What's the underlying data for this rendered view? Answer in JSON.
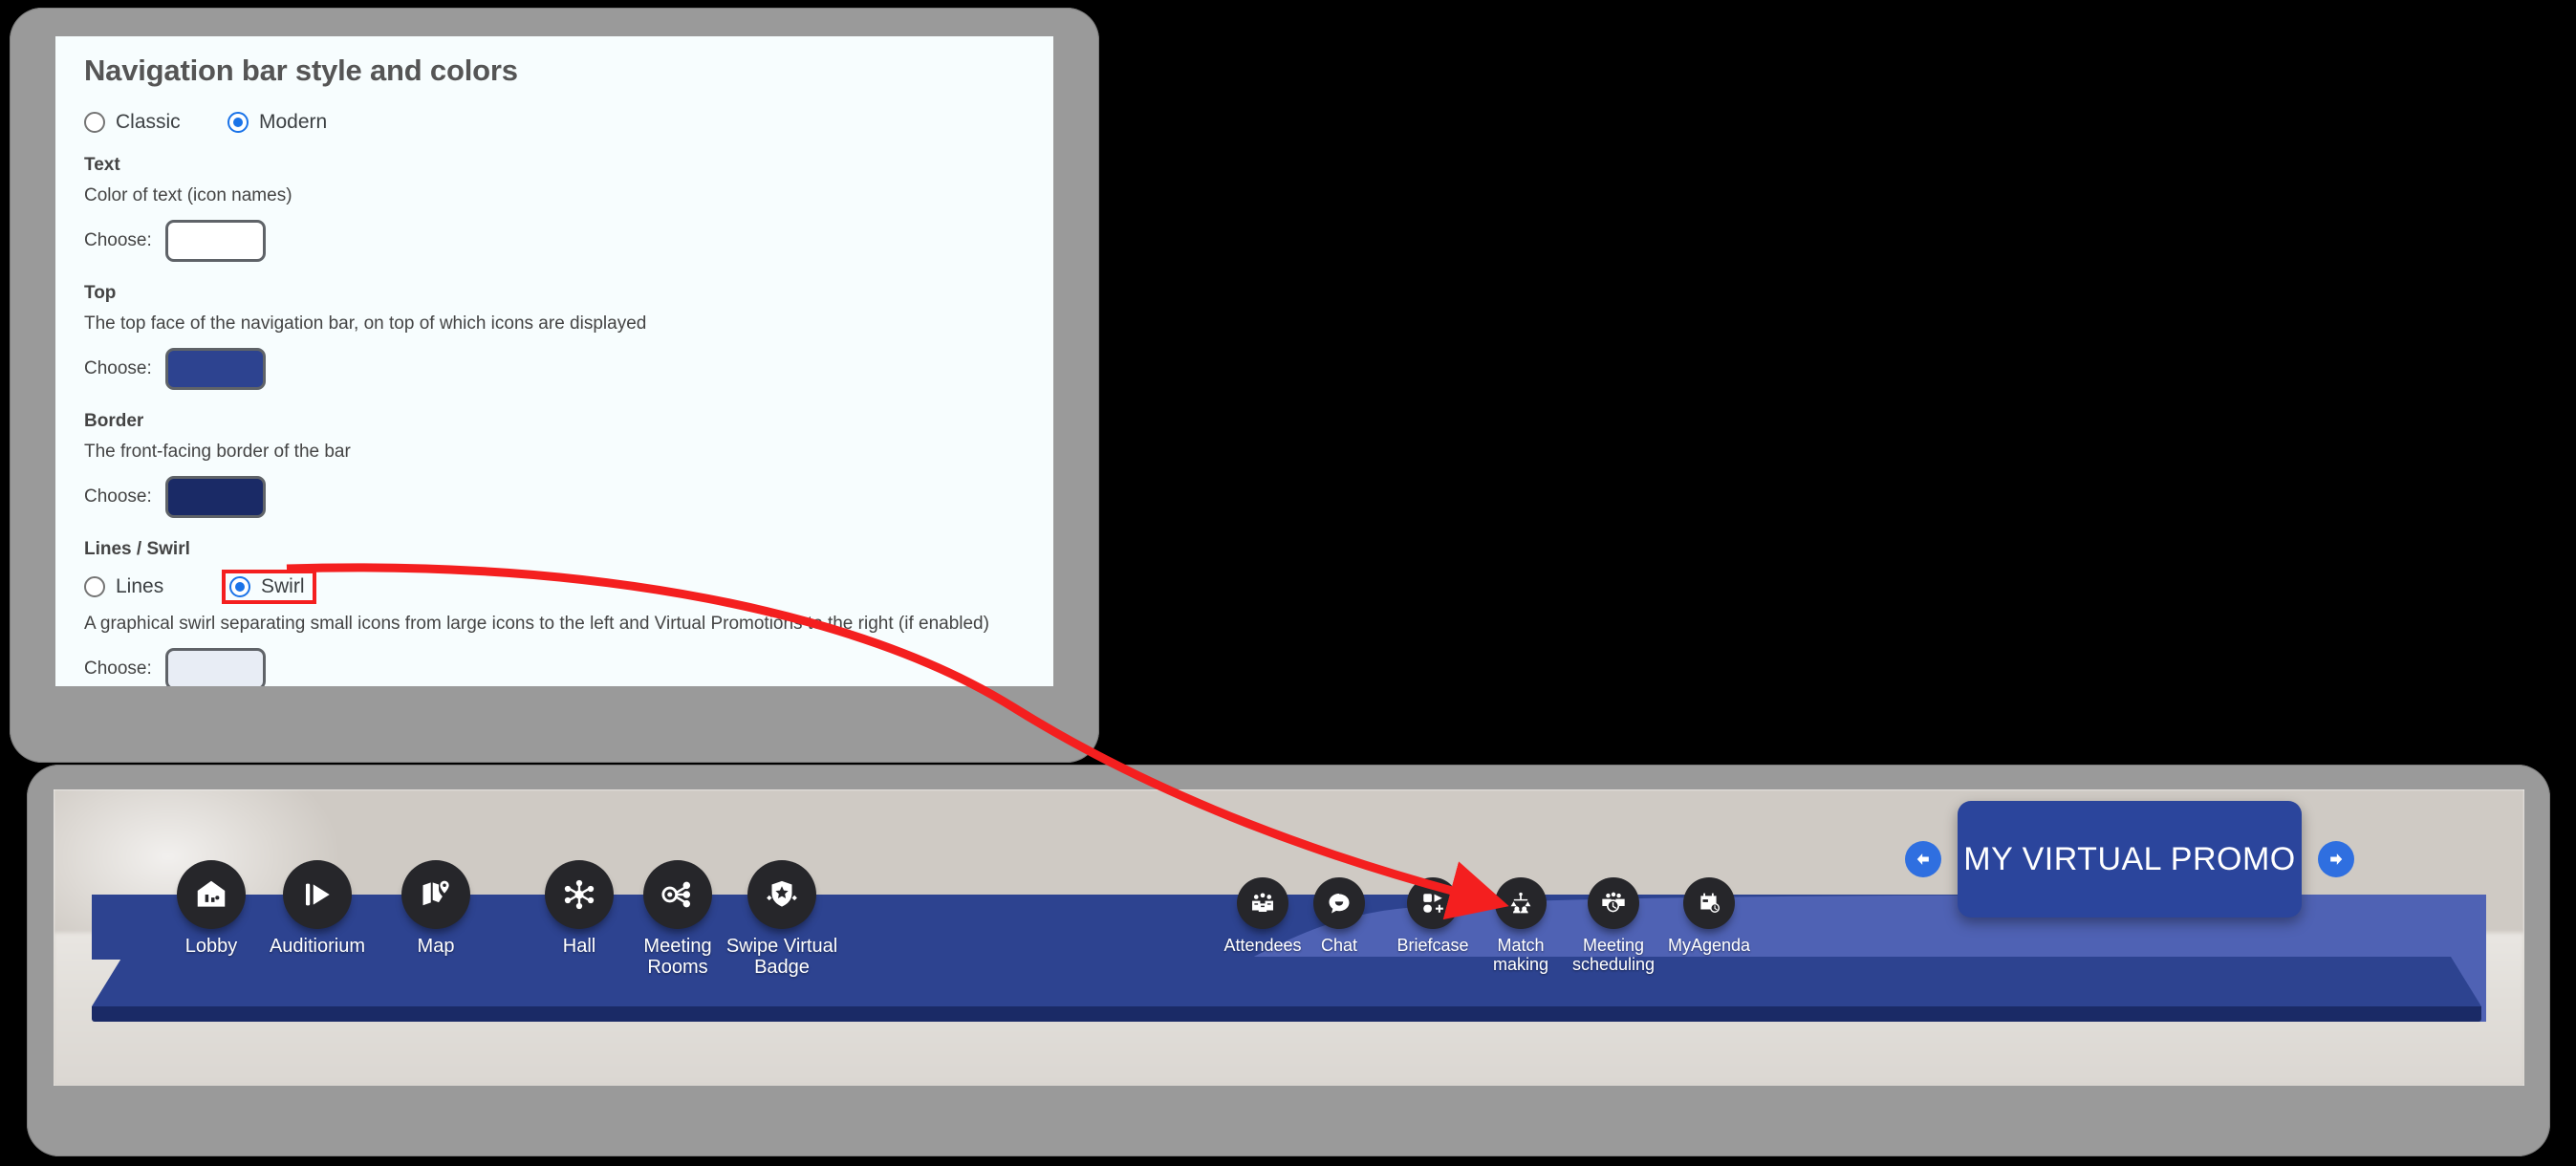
{
  "settings_panel": {
    "title": "Navigation bar style and colors",
    "style_options": [
      {
        "label": "Classic",
        "selected": false
      },
      {
        "label": "Modern",
        "selected": true
      }
    ],
    "choose_label": "Choose:",
    "sections": [
      {
        "name": "Text",
        "description": "Color of text (icon names)",
        "color": "#ffffff"
      },
      {
        "name": "Top",
        "description": "The top face of the navigation bar, on top of which icons are displayed",
        "color": "#2d4390"
      },
      {
        "name": "Border",
        "description": "The front-facing border of the bar",
        "color": "#1a2a66"
      }
    ],
    "lines_swirl": {
      "name": "Lines / Swirl",
      "options": [
        {
          "label": "Lines",
          "selected": false,
          "highlighted": false
        },
        {
          "label": "Swirl",
          "selected": true,
          "highlighted": true
        }
      ],
      "description": "A graphical swirl separating small icons from large icons to the left and Virtual Promotions to the right (if enabled)",
      "color": "#e8edf5"
    }
  },
  "preview": {
    "large_icons": [
      {
        "label": "Lobby",
        "icon": "lobby-icon"
      },
      {
        "label": "Auditiorium",
        "icon": "auditorium-play-icon"
      },
      {
        "label": "Map",
        "icon": "map-pin-icon"
      },
      {
        "label": "Hall",
        "icon": "hall-network-icon"
      },
      {
        "label": "Meeting\nRooms",
        "icon": "meeting-rooms-share-icon"
      },
      {
        "label": "Swipe Virtual\nBadge",
        "icon": "badge-shield-star-icon"
      }
    ],
    "small_icons": [
      {
        "label": "Attendees",
        "icon": "attendees-group-icon"
      },
      {
        "label": "Chat",
        "icon": "chat-bubble-icon"
      },
      {
        "label": "Briefcase",
        "icon": "briefcase-grid-icon"
      },
      {
        "label": "Match\nmaking",
        "icon": "matchmaking-icon"
      },
      {
        "label": "Meeting\nscheduling",
        "icon": "meeting-scheduling-clock-icon"
      },
      {
        "label": "MyAgenda",
        "icon": "myagenda-calendar-icon"
      }
    ],
    "promo": {
      "title": "MY VIRTUAL PROMO",
      "prev_icon": "arrow-left-icon",
      "next_icon": "arrow-right-icon"
    },
    "bar_colors": {
      "top_face": "#2d4390",
      "front_border": "#1a2a66",
      "swirl": "#4f62b4"
    }
  },
  "annotation": {
    "color": "#f41f1f",
    "type": "curved-arrow",
    "from": "swirl-radio-option",
    "to": "navigation-bar-swirl-region"
  }
}
